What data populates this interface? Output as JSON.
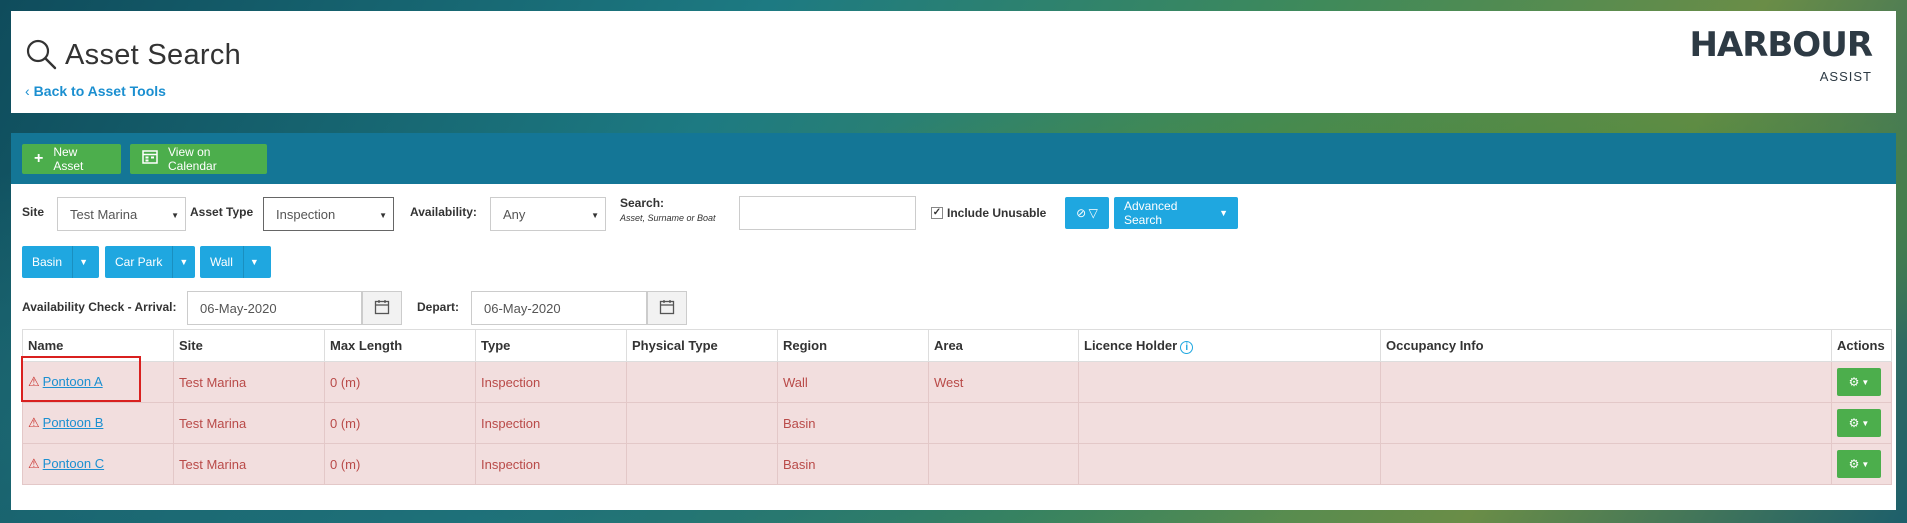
{
  "header": {
    "title": "Asset Search",
    "back_link": "Back to Asset Tools",
    "logo_main": "HARBOUR",
    "logo_sub": "ASSIST"
  },
  "toolbar": {
    "new_asset": "New Asset",
    "view_calendar": "View on Calendar"
  },
  "filters": {
    "site_label": "Site",
    "site_value": "Test Marina",
    "asset_type_label": "Asset Type",
    "asset_type_value": "Inspection",
    "availability_label": "Availability:",
    "availability_value": "Any",
    "search_label": "Search:",
    "search_hint": "Asset, Surname or Boat",
    "search_value": "",
    "include_unusable_label": "Include Unusable",
    "include_unusable_checked": true,
    "advanced_search": "Advanced Search",
    "tags": [
      "Basin",
      "Car Park",
      "Wall"
    ],
    "arrival_label": "Availability Check - Arrival:",
    "arrival_value": "06-May-2020",
    "depart_label": "Depart:",
    "depart_value": "06-May-2020"
  },
  "table": {
    "columns": [
      "Name",
      "Site",
      "Max Length",
      "Type",
      "Physical Type",
      "Region",
      "Area",
      "Licence Holder",
      "Occupancy Info",
      "Actions"
    ],
    "rows": [
      {
        "name": "Pontoon A",
        "site": "Test Marina",
        "max_length": "0 (m)",
        "type": "Inspection",
        "physical_type": "",
        "region": "Wall",
        "area": "West",
        "licence_holder": "",
        "occupancy": ""
      },
      {
        "name": "Pontoon B",
        "site": "Test Marina",
        "max_length": "0 (m)",
        "type": "Inspection",
        "physical_type": "",
        "region": "Basin",
        "area": "",
        "licence_holder": "",
        "occupancy": ""
      },
      {
        "name": "Pontoon C",
        "site": "Test Marina",
        "max_length": "0 (m)",
        "type": "Inspection",
        "physical_type": "",
        "region": "Basin",
        "area": "",
        "licence_holder": "",
        "occupancy": ""
      }
    ]
  },
  "colors": {
    "toolbar_band": "#147696",
    "green_button": "#4cae4c",
    "blue_button": "#1fa7e0",
    "row_danger_bg": "#f2dede",
    "row_danger_text": "#b94a48",
    "link": "#1b8fd0",
    "highlight": "#d9201f"
  }
}
